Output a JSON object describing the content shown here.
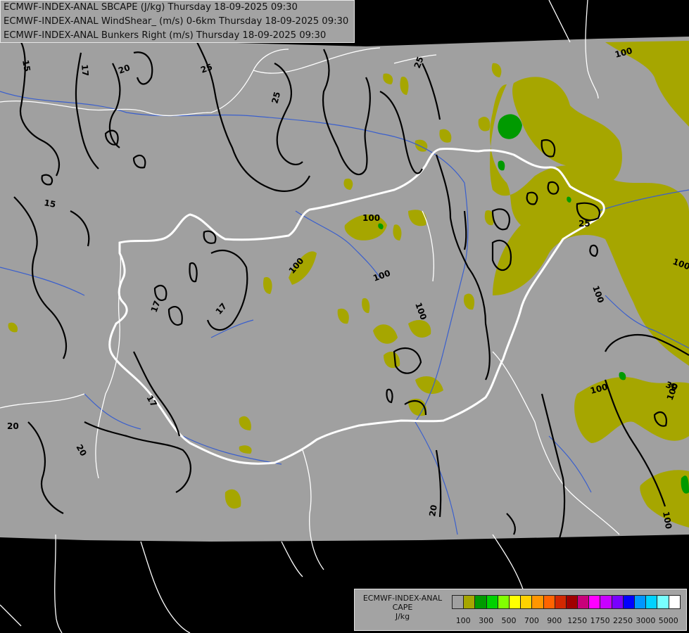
{
  "titles": [
    "ECMWF-INDEX-ANAL SBCAPE (J/kg) Thursday 18-09-2025 09:30",
    "ECMWF-INDEX-ANAL WindShear_ (m/s) 0-6km Thursday 18-09-2025 09:30",
    "ECMWF-INDEX-ANAL Bunkers Right (m/s) Thursday 18-09-2025 09:30"
  ],
  "legend": {
    "title_lines": [
      "ECMWF-INDEX-ANAL",
      "CAPE",
      "J/kg"
    ],
    "colors": [
      "#a0a0a0",
      "#a6a600",
      "#009a00",
      "#00d200",
      "#82ff00",
      "#ffff00",
      "#ffd200",
      "#ff9600",
      "#ff6400",
      "#d22800",
      "#a00000",
      "#c8007a",
      "#ff00ff",
      "#c800ff",
      "#7800ff",
      "#0000ff",
      "#0096ff",
      "#00d2ff",
      "#78ffff",
      "#ffffff"
    ],
    "ticks": [
      "100",
      "300",
      "500",
      "700",
      "900",
      "1250",
      "1750",
      "2250",
      "3000",
      "5000"
    ]
  },
  "contour_labels": [
    "15",
    "17",
    "20",
    "25",
    "15",
    "17",
    "17",
    "20",
    "20",
    "17",
    "20",
    "25",
    "25",
    "25",
    "30",
    "100",
    "100",
    "100",
    "100",
    "100",
    "100",
    "100",
    "100",
    "100",
    "100"
  ],
  "colors": {
    "background": "#000000",
    "domain": "#a0a0a0",
    "cape_100": "#a6a600",
    "cape_300": "#009a00",
    "border": "#ffffff",
    "river": "#3a5fcd",
    "contour": "#000000"
  }
}
